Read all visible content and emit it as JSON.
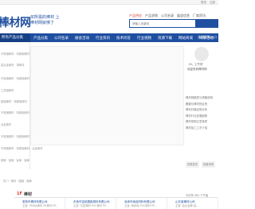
{
  "topbar": {
    "links": [
      "登录",
      "注册"
    ]
  },
  "header": {
    "logo": "棒材网",
    "slogan": "买所需的棒材 上棒材网就够了",
    "search_tabs": [
      "产品供应",
      "产品求购",
      "公司名录",
      "展会信息",
      "厂商资讯"
    ],
    "search_placeholder": "请输入关键词"
  },
  "nav": {
    "items": [
      "所有产品分类",
      "产品分类",
      "公司名录",
      "展会活动",
      "行业资讯",
      "技术问答",
      "行业视频",
      "资源下载",
      "网站商城",
      "商家活动"
    ],
    "hotline": "关键采购入口"
  },
  "catlist": [
    "不锈钢棒材 · 特殊钢棒材 · 合金棒材",
    "铝合金棒材 · 铜棒材",
    "不锈钢棒材 · 特殊钢棒材 · 合金棒材",
    "工具钢棒材",
    "碳钢棒材 · 特殊钢棒材",
    "不锈钢棒材 · 特殊钢棒材 · 合金棒材",
    "合金棒材",
    "不锈钢棒材 · 特殊钢棒材 · 合金棒材",
    "不锈钢棒材 · 特殊钢棒材 · 合金棒材",
    "铜棒 · 铝棒 · 钛棒 · 镍棒"
  ],
  "rightpanel": {
    "welcome": "Hi，上午好",
    "login_line": "欢迎来到棒材网",
    "news": [
      "棒材规格表与规格说明",
      "圆钢与棒材的区别",
      "棒材价格走势分析",
      "棒材行业发展趋势",
      "棒材采购注意事项",
      "棒材加工工艺介绍"
    ],
    "buttons": [
      "供需发布",
      "我要采购"
    ],
    "stats": "今日有 261 个产品"
  },
  "tags": "热门 · 棒材 · 圆钢 · 钢棒",
  "section": {
    "num": "1F",
    "title": "棒材",
    "cards": [
      {
        "name": "常熟市棒材有限公司",
        "info": "主营: PMMA棒材 PE棒材 PP..."
      },
      {
        "name": "东莞市富临塑胶原料有限公司",
        "info": "主营: 石墨棒材 PVC棒材 PE..."
      },
      {
        "name": "深圳市纳诺材料有限公司",
        "info": "主营: 纳米碳 PVC棒材 PE..."
      },
      {
        "name": "山东某棒材公司",
        "info": "主营: 钛合金棒 铝..."
      }
    ]
  },
  "colors": {
    "brand": "#1f4fa0",
    "accent": "#d93b2a"
  }
}
